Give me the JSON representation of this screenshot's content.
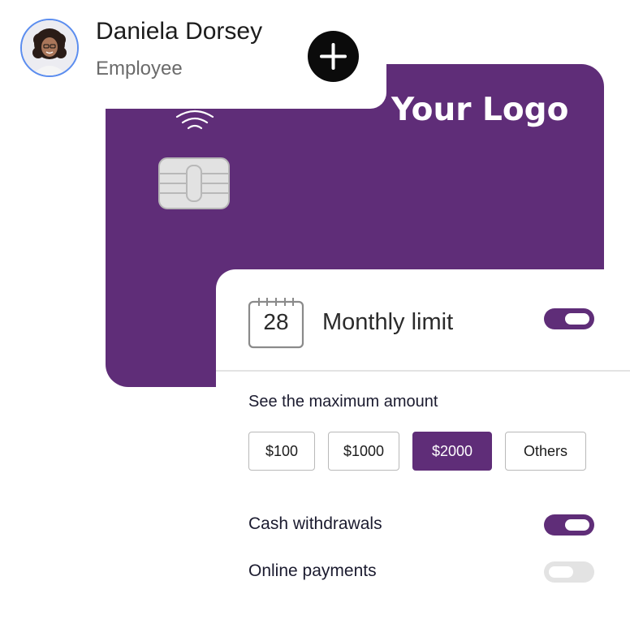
{
  "user": {
    "name": "Daniela Dorsey",
    "role": "Employee"
  },
  "card": {
    "logo_text": "Your Logo"
  },
  "monthly_limit": {
    "calendar_day": "28",
    "label": "Monthly limit",
    "enabled": true
  },
  "amount_section": {
    "label": "See the maximum amount",
    "options": [
      "$100",
      "$1000",
      "$2000",
      "Others"
    ],
    "selected": "$2000"
  },
  "settings": {
    "cash_withdrawals": {
      "label": "Cash withdrawals",
      "enabled": true
    },
    "online_payments": {
      "label": "Online payments",
      "enabled": false
    }
  },
  "colors": {
    "brand": "#5f2d78",
    "toggle_off": "#e3e3e3",
    "avatar_ring": "#5b8def"
  }
}
